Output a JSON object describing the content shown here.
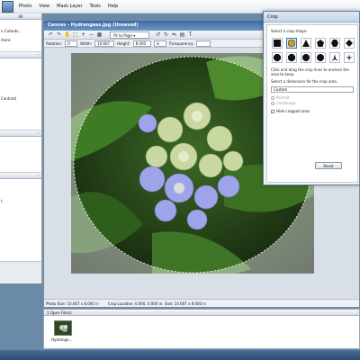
{
  "menubar": {
    "items": [
      "Photo",
      "View",
      "Mask Layer",
      "Tools",
      "Help"
    ]
  },
  "left_panel": {
    "header": "All",
    "items_top": [
      "n Cutouts...",
      "mera"
    ],
    "items_mid": [
      "Contrast"
    ],
    "items_bottom": [
      "t"
    ]
  },
  "canvas": {
    "title": "Canvas - Hydrangeas.jpg (Unsaved)",
    "fit_to_page": "Fit to Page",
    "rotation_label": "Rotation:",
    "rotation_value": "0",
    "width_label": "Width:",
    "width_value": "10.667",
    "height_label": "Height:",
    "height_value": "8.000",
    "in_unit": "in",
    "transparency_label": "Transparency:",
    "status_size": "Photo Size: 10.667 x 8.000 in",
    "status_location": "Crop Location: 0.000, 0.000 in. Size: 10.667 x 8.000 in"
  },
  "open_files": {
    "header": "1 Open File(s)",
    "thumb_label": "Hydrange..."
  },
  "crop_dialog": {
    "title": "Crop",
    "select_shape": "Select a crop shape.",
    "shapes": [
      "square-shape",
      "ellipse-shape",
      "triangle-shape",
      "pentagon-shape",
      "hexagon-shape",
      "diamond-shape",
      "octagon-shape",
      "octagon2-shape",
      "circle-shape",
      "circle2-shape",
      "wedge-shape",
      "star-shape"
    ],
    "instructions": "Click and drag the crop lines to enclose the area to keep.",
    "dimension_label": "Select a dimension for the crop area.",
    "dimension_value": "Custom",
    "portrait": "Portrait",
    "landscape": "Landscape",
    "hide_cropped": "Hide cropped area",
    "reset": "Reset"
  }
}
